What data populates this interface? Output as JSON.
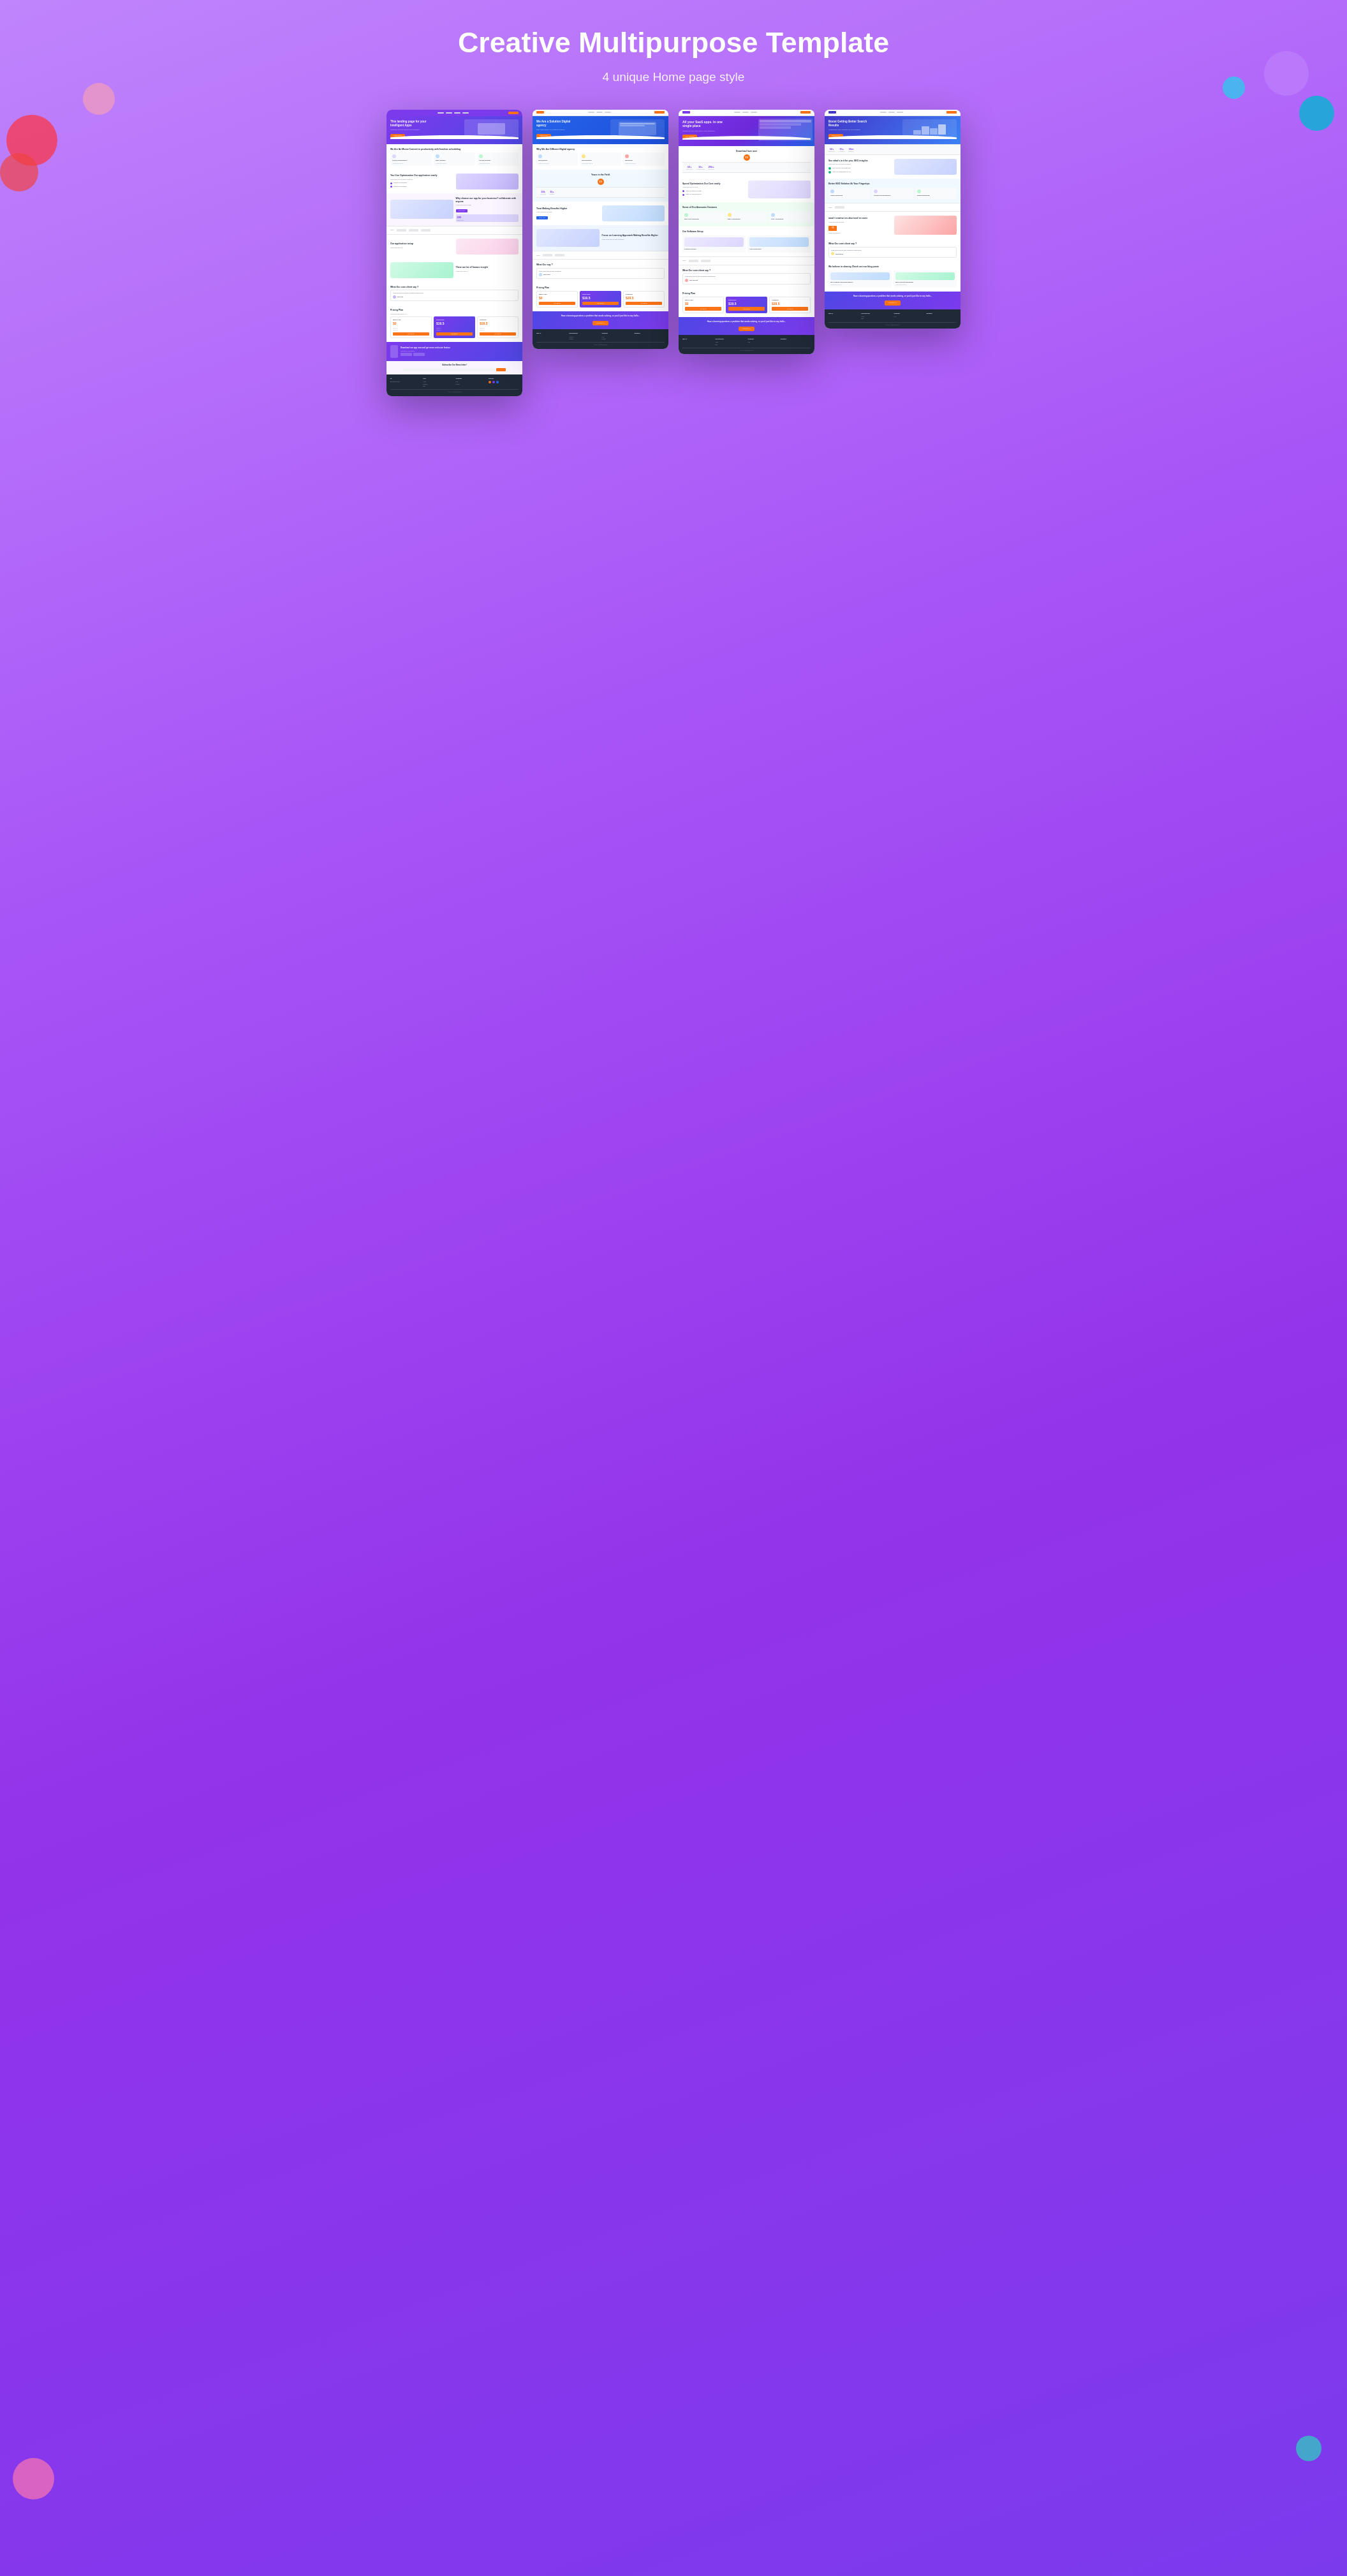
{
  "header": {
    "title": "Creative Multipurpose Template",
    "subtitle": "4 unique Home page style"
  },
  "blobs": [
    {
      "name": "pink",
      "class": "blob-pink"
    },
    {
      "name": "red",
      "class": "blob-red"
    },
    {
      "name": "peach",
      "class": "blob-peach"
    },
    {
      "name": "teal",
      "class": "blob-teal"
    },
    {
      "name": "purple-light",
      "class": "blob-purple-light"
    },
    {
      "name": "cyan",
      "class": "blob-cyan"
    },
    {
      "name": "bottom-pink",
      "class": "blob-bottom-pink"
    },
    {
      "name": "bottom-teal",
      "class": "blob-bottom-teal"
    }
  ],
  "pages": [
    {
      "id": "page1",
      "nav": {
        "logo": "m",
        "btn": "Buy Now"
      },
      "hero": {
        "class": "wp-hero-purple",
        "title": "This landing page for your Intelligent Apps",
        "subtitle": "Download our app now and get more exclusive feature",
        "btn": "Learn More"
      },
      "sections": [
        {
          "title": "We Are An Momo Commit to productivity with freedom scheduling",
          "type": "features-3"
        },
        {
          "title": "You Can Optimization Our application easily",
          "type": "two-col"
        },
        {
          "title": "Why choose our app for your business ? collaborate with anyone",
          "type": "two-col-reverse"
        },
        {
          "title": "Our application setup",
          "type": "two-col"
        },
        {
          "title": "There are lot of feature insight",
          "type": "two-col-reverse"
        },
        {
          "title": "What Our core client say ?",
          "type": "testimonials"
        },
        {
          "title": "Pricing Plan",
          "type": "pricing"
        }
      ],
      "cta": {
        "title": "Download our app now and get more exclusive feature",
        "btn": "App Store",
        "btn2": "Google Play"
      },
      "newsletter": {
        "title": "Subscribe Our News letter!"
      },
      "footer": true
    },
    {
      "id": "page2",
      "nav": {
        "logo": "Moc.o",
        "btn": "Get Started"
      },
      "hero": {
        "class": "wp-hero-blue",
        "title": "We Are a Solution Digital agency",
        "subtitle": "Best agency for creative digital solutions",
        "btn": "Learn More"
      },
      "sections": [
        {
          "title": "Why We Are Different Digital agency",
          "type": "features-3"
        },
        {
          "title": "Years in the Field",
          "type": "stats-badge"
        },
        {
          "title": "Treat Making Benefits Higher",
          "type": "two-col"
        },
        {
          "title": "Focus on Learning Approach Making Benefits Higher",
          "type": "two-col-reverse"
        },
        {
          "title": "What Our say ?",
          "type": "testimonials"
        },
        {
          "title": "Pricing Plan",
          "type": "pricing"
        }
      ],
      "question": {
        "title": "Have a burning question, a problem that needs solving, or you'd just like to say hello...",
        "btn": "Contact Us"
      },
      "footer": true
    },
    {
      "id": "page3",
      "nav": {
        "logo": "Moc.o",
        "btn": "Get Started"
      },
      "hero": {
        "class": "wp-hero-violet",
        "title": "All your SaaS apps. In one single place",
        "subtitle": "Manage all your SaaS applications in one dashboard",
        "btn": "Get Started"
      },
      "sections": [
        {
          "title": "Download love user",
          "type": "stats-badge"
        },
        {
          "title": "Spend Optimization Our Care easily",
          "type": "two-col"
        },
        {
          "title": "Some of Our Awesome Gestures",
          "type": "features-3"
        },
        {
          "title": "Our Software Setup",
          "type": "software-setup"
        },
        {
          "title": "What Our core client say ?",
          "type": "testimonials"
        },
        {
          "title": "Pricing Plan",
          "type": "pricing"
        }
      ],
      "question": {
        "title": "Have a burning question, a problem that needs solving, or you'd just like to say hello...",
        "btn": "Contact Us"
      },
      "footer": true
    },
    {
      "id": "page4",
      "nav": {
        "logo": "Moc.o",
        "btn": "Get Started"
      },
      "hero": {
        "class": "wp-hero-indigo",
        "title": "Boost Getting Better Search Results",
        "subtitle": "Professional SEO solutions for your business growth",
        "btn": "Learn More"
      },
      "sections": [
        {
          "title": "See what's in it for you, SEO insights",
          "type": "features-list"
        },
        {
          "title": "Better SEO Solution At Your Fingertips",
          "type": "features-3"
        },
        {
          "title": "ional / creative ies also tend to cover",
          "type": "two-col"
        },
        {
          "title": "What Our core client say ?",
          "type": "testimonials"
        },
        {
          "title": "We believe in sharing Check out our blog posts",
          "type": "blog"
        }
      ],
      "question": {
        "title": "Have a burning question, a problem that needs solving, or you'd just like to say hello...",
        "btn": "Contact Us"
      },
      "footer": true
    }
  ],
  "stats": [
    {
      "num": "13",
      "label": "Years in the Field"
    },
    {
      "num": "12k",
      "label": "Happy Customers"
    },
    {
      "num": "15+",
      "label": "Countries Served"
    },
    {
      "num": "15m",
      "label": "Downloads"
    }
  ],
  "pricing": {
    "plans": [
      {
        "name": "Basic Free",
        "price": "$0",
        "featured": false
      },
      {
        "name": "Enterprise",
        "price": "$19.5",
        "featured": true
      },
      {
        "name": "Premium",
        "price": "$29.5",
        "featured": false
      }
    ]
  },
  "colors": {
    "purple": "#7c3aed",
    "blue": "#2563eb",
    "orange": "#f97316",
    "teal": "#22d3ee",
    "pink": "#f43f5e"
  }
}
